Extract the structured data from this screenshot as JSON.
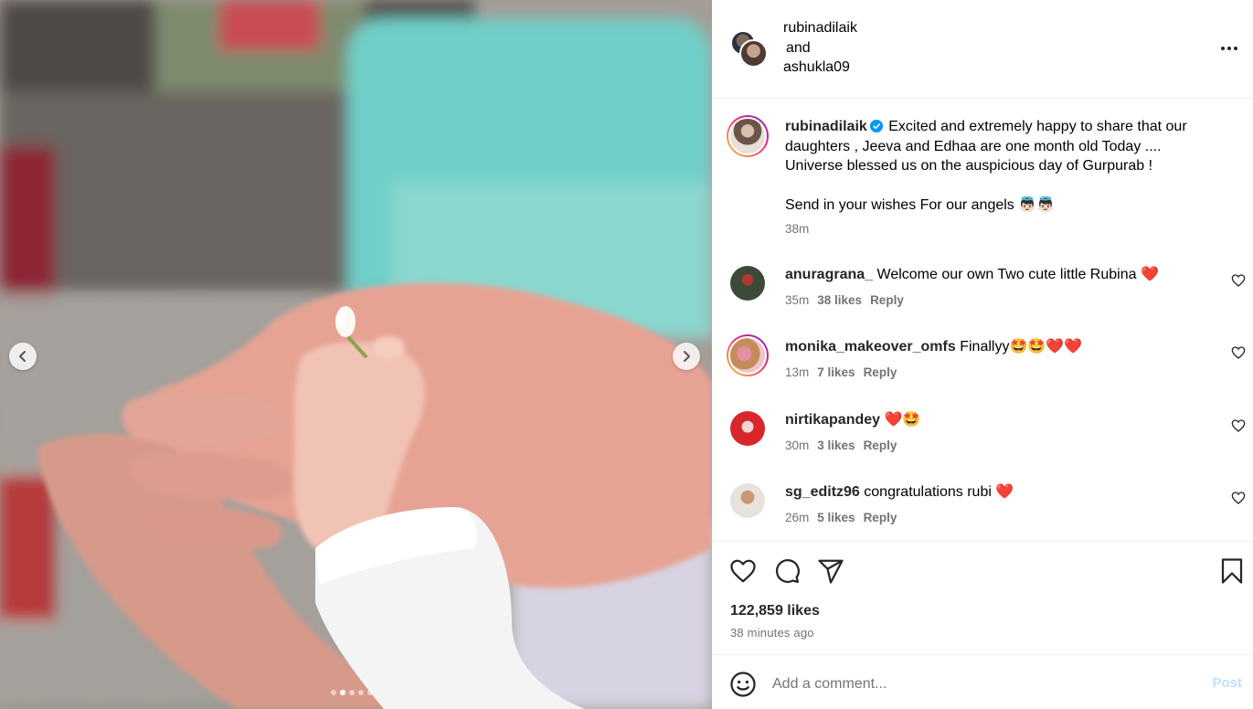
{
  "post": {
    "header": {
      "author1": "rubinadilaik",
      "joiner": "and",
      "author2": "ashukla09"
    },
    "caption": {
      "username": "rubinadilaik",
      "line1": "Excited and extremely happy to share that our daughters , Jeeva and Edhaa are one month old Today .... Universe blessed us on the auspicious day of Gurpurab !",
      "line2": "Send in your wishes For our angels 👼🏻👼🏻",
      "time": "38m"
    },
    "comments": [
      {
        "username": "anuragrana_",
        "text": "Welcome our own Two cute little Rubina",
        "emoji": "❤️",
        "time": "35m",
        "likes": "38 likes",
        "reply": "Reply"
      },
      {
        "username": "monika_makeover_omfs",
        "text": "Finallyy",
        "emoji": "🤩🤩❤️❤️",
        "time": "13m",
        "likes": "7 likes",
        "reply": "Reply"
      },
      {
        "username": "nirtikapandey",
        "text": "",
        "emoji": "❤️🤩",
        "time": "30m",
        "likes": "3 likes",
        "reply": "Reply"
      },
      {
        "username": "sg_editz96",
        "text": "congratulations rubi",
        "emoji": "❤️",
        "time": "26m",
        "likes": "5 likes",
        "reply": "Reply"
      }
    ],
    "likes": "122,859 likes",
    "time_ago": "38 minutes ago",
    "add_comment_placeholder": "Add a comment...",
    "post_label": "Post",
    "carousel": {
      "slide_count": 5,
      "active_index": 1
    }
  },
  "colors": {
    "accent": "#0095f6",
    "post_disabled": "#c0dffd",
    "secondary_text": "#737373",
    "divider": "#efefef"
  },
  "icons": [
    "chevron-left-icon",
    "chevron-right-icon",
    "more-icon",
    "verified-icon",
    "heart-icon",
    "comment-icon",
    "share-icon",
    "bookmark-icon",
    "emoji-icon"
  ]
}
